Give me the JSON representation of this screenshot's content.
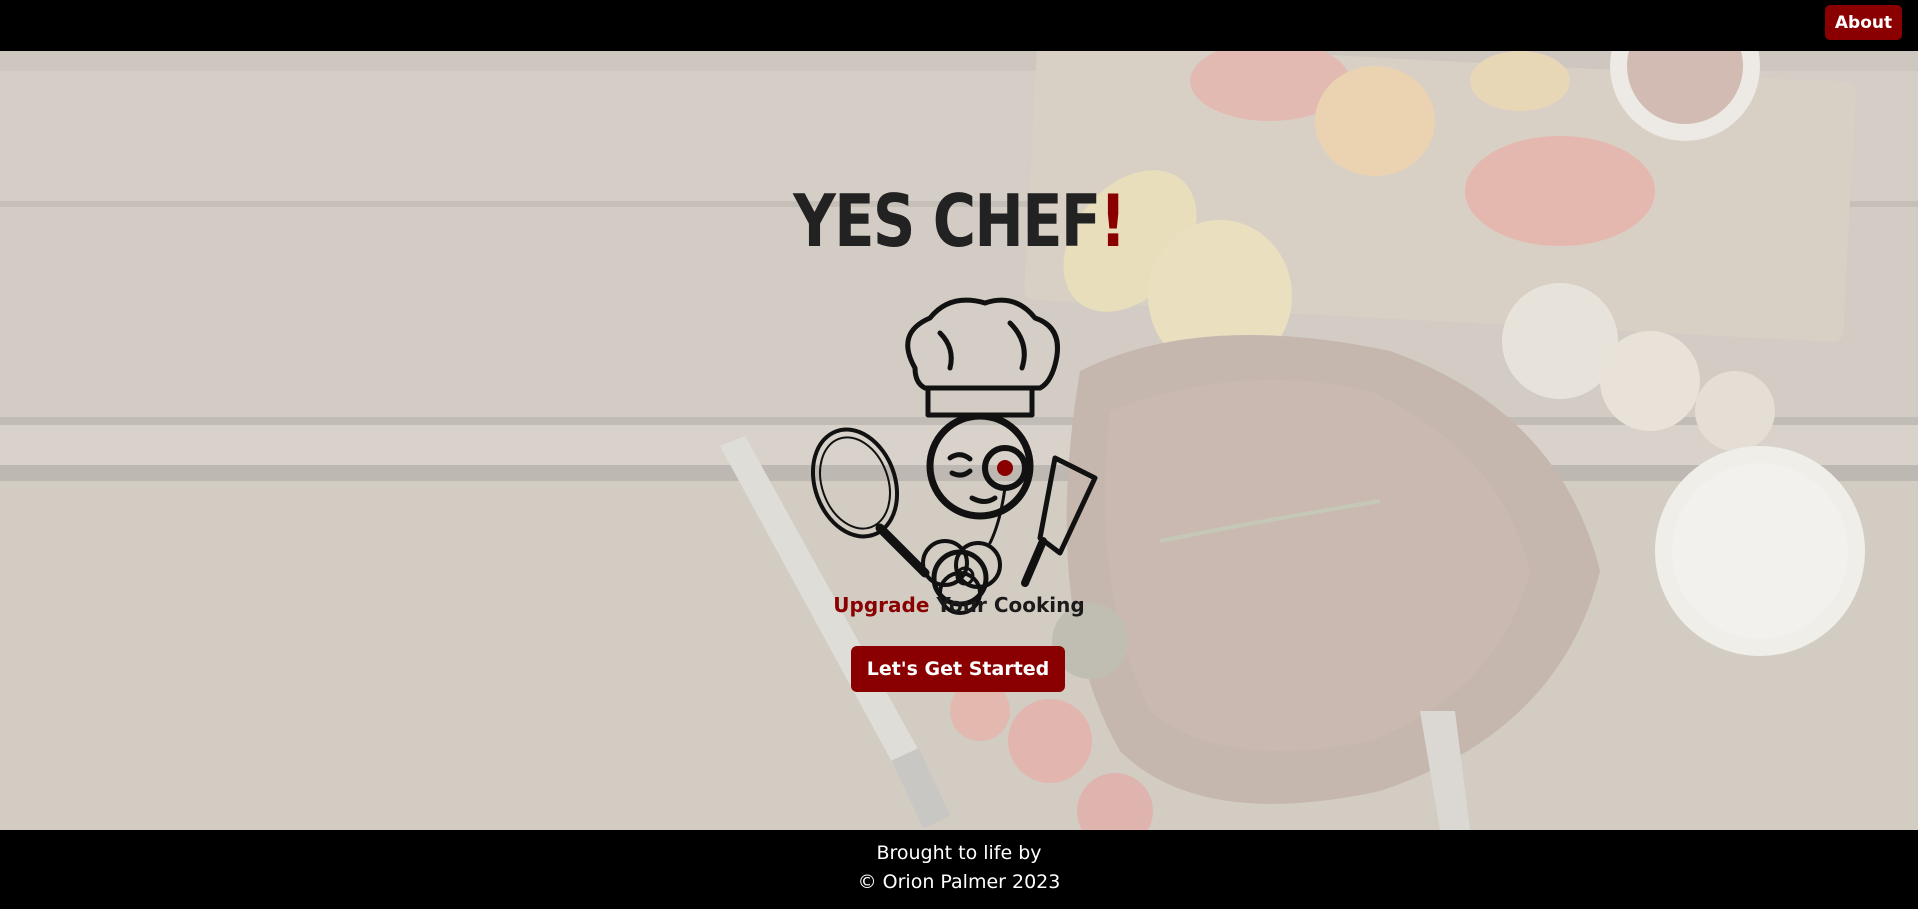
{
  "nav": {
    "about_label": "About"
  },
  "hero": {
    "title_main": "YES CHEF",
    "title_bang": "!",
    "tagline_accent": "Upgrade",
    "tagline_rest": " Your Cooking",
    "cta_label": "Let's Get Started"
  },
  "logo": {
    "icon": "chef-mascot-icon"
  },
  "footer": {
    "line1": "Brought to life by",
    "line2": "© Orion Palmer 2023"
  },
  "colors": {
    "brand": "#8a0000",
    "bar": "#000000",
    "text": "#222222"
  }
}
